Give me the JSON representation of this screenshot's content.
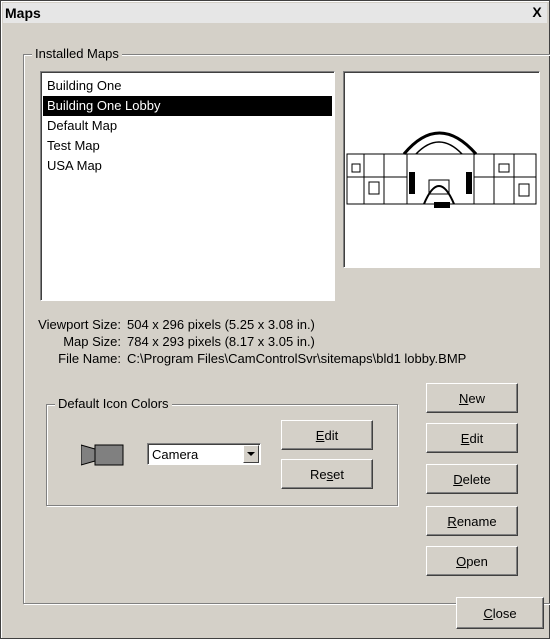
{
  "window": {
    "title": "Maps",
    "close_glyph": "X"
  },
  "installed_maps": {
    "legend": "Installed Maps",
    "items": [
      {
        "label": "Building One",
        "selected": false
      },
      {
        "label": "Building One Lobby",
        "selected": true
      },
      {
        "label": "Default Map",
        "selected": false
      },
      {
        "label": "Test Map",
        "selected": false
      },
      {
        "label": "USA Map",
        "selected": false
      }
    ],
    "preview_icon": "floorplan-preview-icon"
  },
  "info": {
    "viewport_label": "Viewport Size:",
    "viewport_value": "504 x 296 pixels (5.25 x 3.08 in.)",
    "mapsize_label": "Map Size:",
    "mapsize_value": "784 x 293 pixels (8.17 x 3.05 in.)",
    "filename_label": "File Name:",
    "filename_value": "C:\\Program Files\\CamControlSvr\\sitemaps\\bld1 lobby.BMP"
  },
  "icon_colors": {
    "legend": "Default Icon Colors",
    "icon": "camera-icon",
    "select_value": "Camera",
    "edit_label_u": "E",
    "edit_label_rest": "dit",
    "reset_label_pre": "Re",
    "reset_label_u": "s",
    "reset_label_rest": "et"
  },
  "side_buttons": {
    "new_u": "N",
    "new_rest": "ew",
    "edit_u": "E",
    "edit_rest": "dit",
    "delete_u": "D",
    "delete_rest": "elete",
    "rename_u": "R",
    "rename_rest": "ename",
    "open_u": "O",
    "open_rest": "pen"
  },
  "footer": {
    "close_u": "C",
    "close_rest": "lose"
  },
  "colors": {
    "dialog_bg": "#d4d0c8",
    "selection_bg": "#000000",
    "selection_fg": "#ffffff"
  }
}
